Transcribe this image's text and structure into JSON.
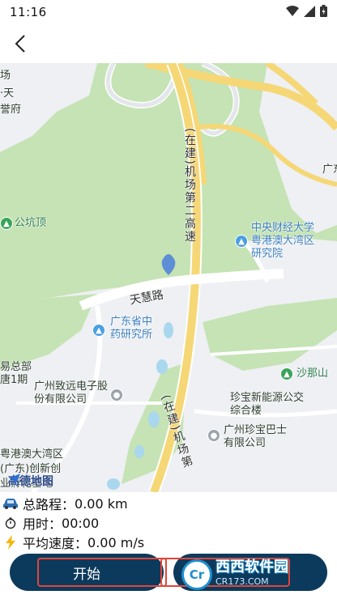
{
  "status_bar": {
    "time": "11:16",
    "icons": [
      "wifi-icon",
      "signal-icon",
      "battery-icon"
    ]
  },
  "header": {
    "back_icon": "chevron-left-icon"
  },
  "map": {
    "labels": {
      "tl1": "场",
      "tl2": "·天",
      "tl3": "誉府",
      "gongkengding": "公坑顶",
      "road_zaijian_1": "(在建)机场第二高速",
      "tianhui_road": "天慧路",
      "zhongyang": "中央财经大学粤港澳大湾区研究院",
      "guangdong_zhong": "广东省中药研究所",
      "yizongbu": "易总部唐1期",
      "zhiyuan": "广州致远电子股份有限公司",
      "shanashan": "沙那山",
      "zhenbao_newenergy": "珍宝新能源公交综合楼",
      "zhenbao_bashi": "广州珍宝巴士有限公司",
      "road_zaijian_2": "(在建)机场第",
      "gba_bottom1": "粤港澳大湾区",
      "gba_bottom2": "(广东)创新创",
      "gba_bottom3": "业孵化基地",
      "right_guang": "广东文"
    },
    "logo": "高德地图",
    "colors": {
      "green": "#c5e3b4",
      "urban": "#eef0f3",
      "road_yellow": "#f6d776",
      "road_white": "#ffffff",
      "water": "#a9d7ee"
    }
  },
  "stats": {
    "distance": {
      "icon": "car-icon",
      "label": "总路程：",
      "value": "0.00 km"
    },
    "time": {
      "icon": "stopwatch-icon",
      "label": "用时：",
      "value": "00:00"
    },
    "speed": {
      "icon": "lightning-icon",
      "label": "平均速度：",
      "value": "0.00 m/s"
    }
  },
  "buttons": {
    "start": "开始",
    "other": ""
  },
  "watermark": {
    "main": "西西软件园",
    "sub": "CR173.COM",
    "badge": "Cr"
  },
  "colors": {
    "button_bg": "#0c3a5c",
    "highlight": "#e0453a"
  }
}
